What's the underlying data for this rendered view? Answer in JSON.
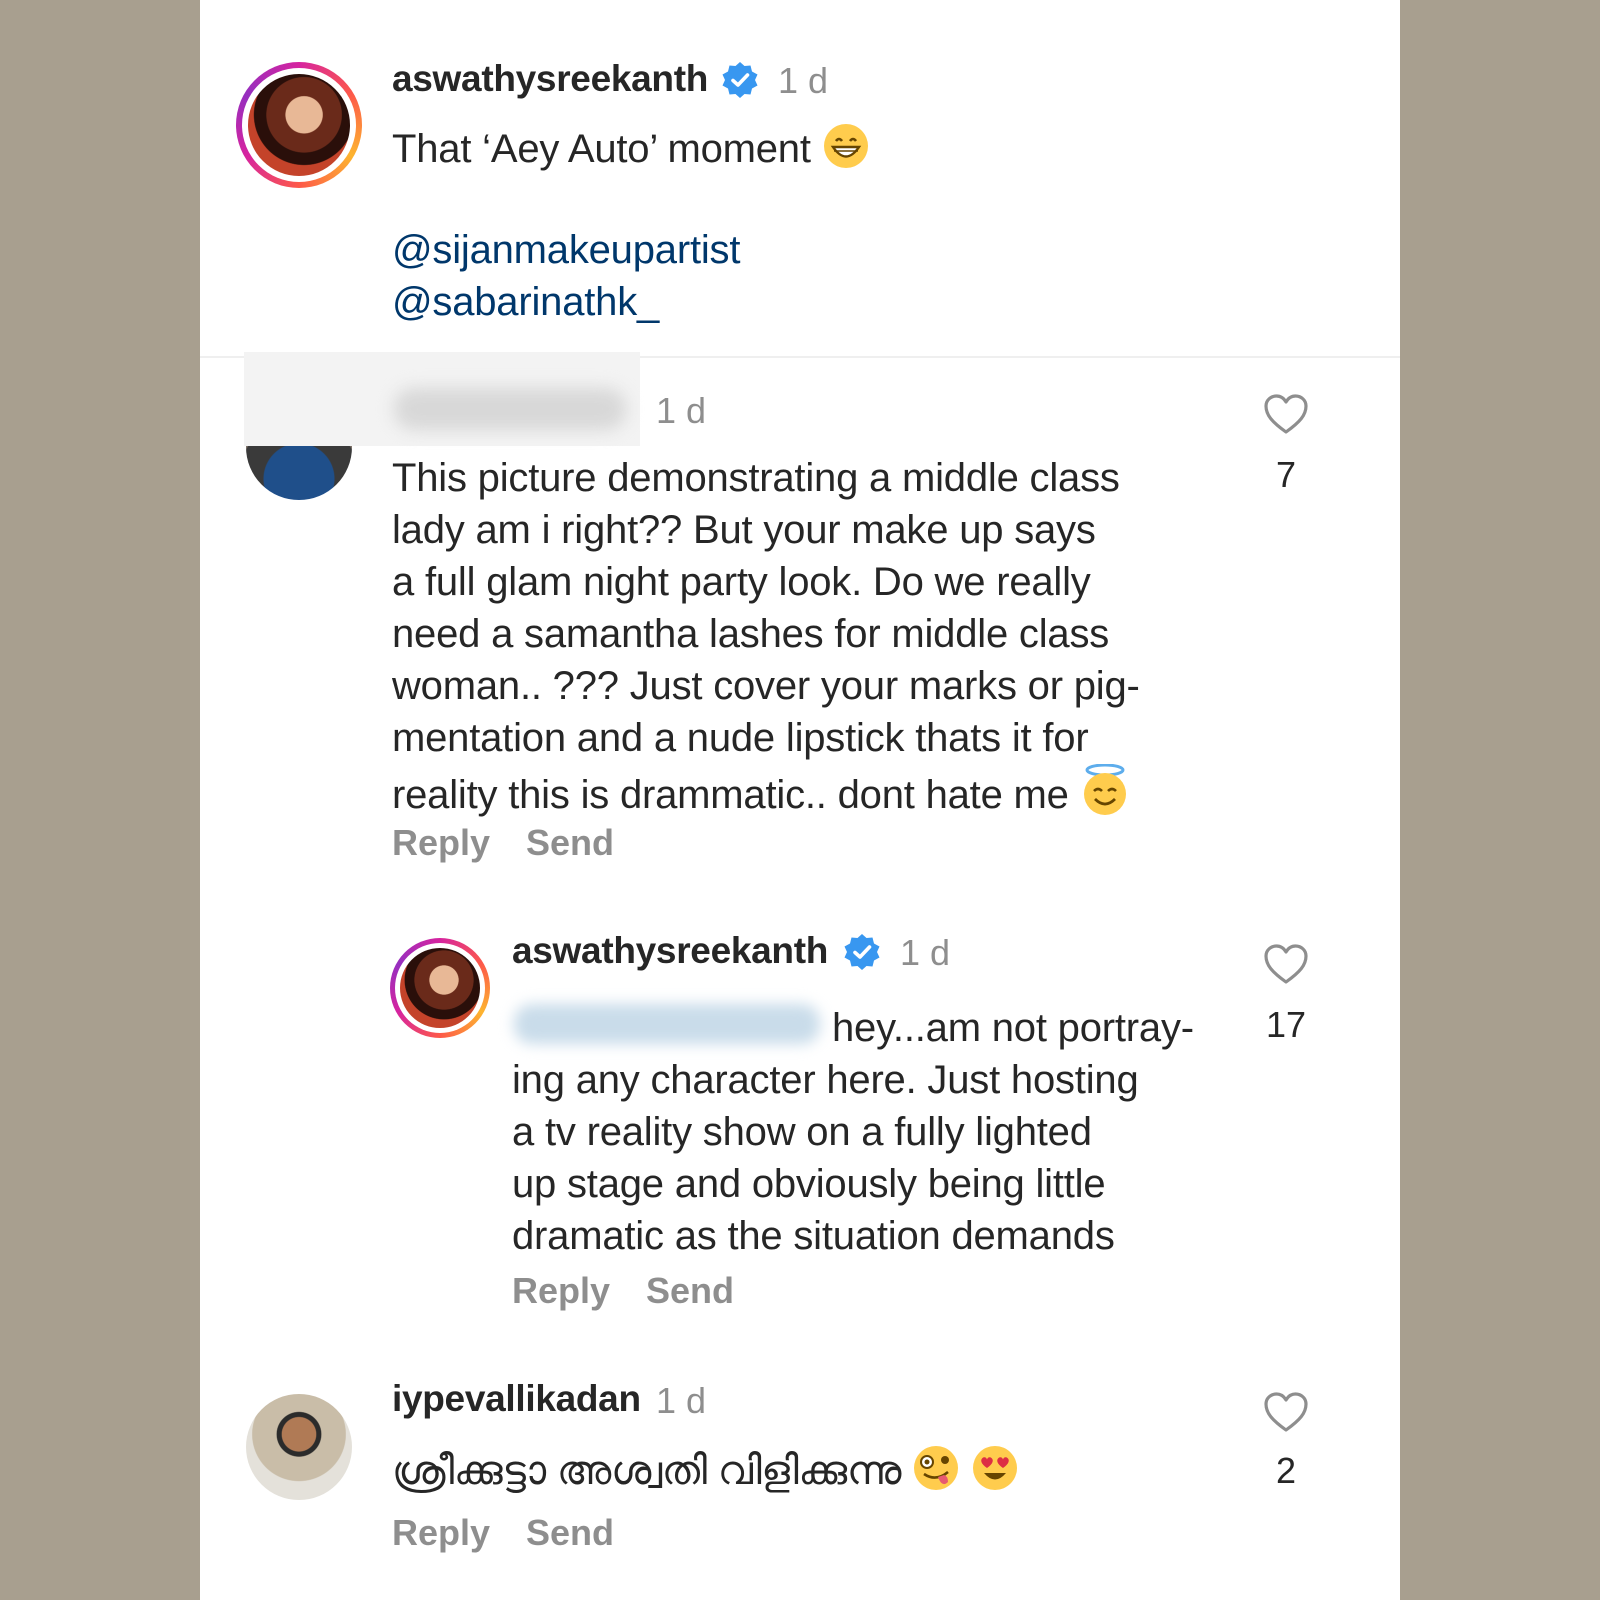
{
  "caption": {
    "username": "aswathysreekanth",
    "time": "1 d",
    "text": "That ‘Aey Auto’ moment",
    "emoji": "grinning-face",
    "mentions": [
      "@sijanmakeupartist",
      "@sabarinathk_"
    ]
  },
  "comments": [
    {
      "username_hidden": true,
      "time": "1 d",
      "lines": [
        "This picture demonstrating a middle class",
        "lady am i right?? But your make up says",
        "a full glam night party look. Do we really",
        "need a samantha lashes for middle class",
        "woman.. ??? Just cover your marks or pig-",
        "mentation and a nude lipstick thats it for",
        "reality this is drammatic.. dont hate me"
      ],
      "emoji": "smiling-face-with-halo",
      "likes": "7",
      "reply_label": "Reply",
      "send_label": "Send"
    },
    {
      "username": "aswathysreekanth",
      "time": "1 d",
      "lines": [
        "hey...am not portray-",
        "ing any character here. Just hosting",
        "a tv reality show on a fully lighted",
        "up stage and obviously being little",
        "dramatic as the situation demands"
      ],
      "likes": "17",
      "reply_label": "Reply",
      "send_label": "Send"
    },
    {
      "username": "iypevallikadan",
      "time": "1 d",
      "text": "ശ്രീക്കുട്ടാ  അശ്വതി വിളിക്കുന്നു",
      "emojis": [
        "zany-face",
        "heart-eyes-face"
      ],
      "likes": "2",
      "reply_label": "Reply",
      "send_label": "Send"
    }
  ],
  "colors": {
    "background": "#a89f8f",
    "panel": "#ffffff",
    "text": "#262626",
    "muted": "#8e8e8e",
    "mention": "#00376b",
    "verified": "#3897f0"
  }
}
